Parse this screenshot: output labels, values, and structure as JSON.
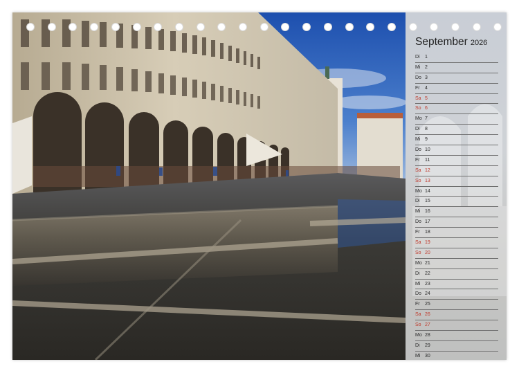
{
  "calendar": {
    "month": "September",
    "year": "2026",
    "days": [
      {
        "dow": "Di",
        "date": "1",
        "weekend": false
      },
      {
        "dow": "Mi",
        "date": "2",
        "weekend": false
      },
      {
        "dow": "Do",
        "date": "3",
        "weekend": false
      },
      {
        "dow": "Fr",
        "date": "4",
        "weekend": false
      },
      {
        "dow": "Sa",
        "date": "5",
        "weekend": true
      },
      {
        "dow": "So",
        "date": "6",
        "weekend": true
      },
      {
        "dow": "Mo",
        "date": "7",
        "weekend": false
      },
      {
        "dow": "Di",
        "date": "8",
        "weekend": false
      },
      {
        "dow": "Mi",
        "date": "9",
        "weekend": false
      },
      {
        "dow": "Do",
        "date": "10",
        "weekend": false
      },
      {
        "dow": "Fr",
        "date": "11",
        "weekend": false
      },
      {
        "dow": "Sa",
        "date": "12",
        "weekend": true
      },
      {
        "dow": "So",
        "date": "13",
        "weekend": true
      },
      {
        "dow": "Mo",
        "date": "14",
        "weekend": false
      },
      {
        "dow": "Di",
        "date": "15",
        "weekend": false
      },
      {
        "dow": "Mi",
        "date": "16",
        "weekend": false
      },
      {
        "dow": "Do",
        "date": "17",
        "weekend": false
      },
      {
        "dow": "Fr",
        "date": "18",
        "weekend": false
      },
      {
        "dow": "Sa",
        "date": "19",
        "weekend": true
      },
      {
        "dow": "So",
        "date": "20",
        "weekend": true
      },
      {
        "dow": "Mo",
        "date": "21",
        "weekend": false
      },
      {
        "dow": "Di",
        "date": "22",
        "weekend": false
      },
      {
        "dow": "Mi",
        "date": "23",
        "weekend": false
      },
      {
        "dow": "Do",
        "date": "24",
        "weekend": false
      },
      {
        "dow": "Fr",
        "date": "25",
        "weekend": false
      },
      {
        "dow": "Sa",
        "date": "26",
        "weekend": true
      },
      {
        "dow": "So",
        "date": "27",
        "weekend": true
      },
      {
        "dow": "Mo",
        "date": "28",
        "weekend": false
      },
      {
        "dow": "Di",
        "date": "29",
        "weekend": false
      },
      {
        "dow": "Mi",
        "date": "30",
        "weekend": false
      }
    ]
  },
  "binding": {
    "hole_count": 23
  },
  "colors": {
    "weekend_text": "#c0392b",
    "weekday_text": "#2a2a2a",
    "sky": "#2f63b8",
    "building": "#c9bfa8",
    "water": "#2b2a26"
  }
}
